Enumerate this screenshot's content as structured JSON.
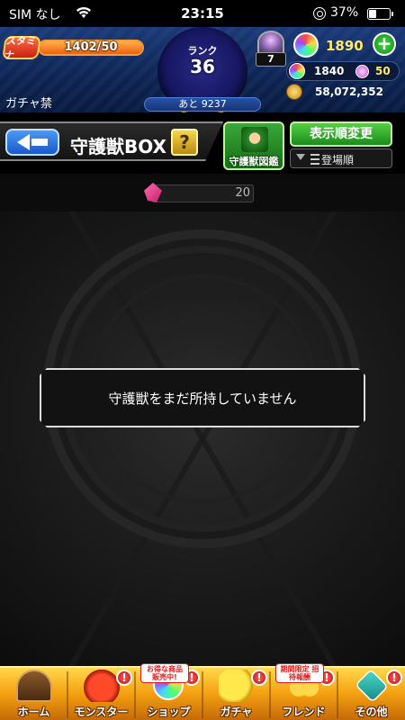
{
  "status_bar": {
    "carrier": "SIM なし",
    "time": "23:15",
    "battery_pct": "37%",
    "battery_level": 0.37
  },
  "header": {
    "stamina_label": "スタミナ",
    "stamina_text": "1402/50",
    "stamina_fill": 1.0,
    "rank_label": "ランク",
    "rank_value": "36",
    "next_rank_text": "あと 9237",
    "gacha_label": "ガチャ禁",
    "tray_count": "7",
    "orb_count": "1890",
    "plus_label": "+",
    "sub_orb_count": "1840",
    "pink_orb_count": "50",
    "coin_count": "58,072,352",
    "colors": {
      "accent": "#ffe86a",
      "header_bg": "#0d2453"
    }
  },
  "title_row": {
    "title": "守護獣BOX",
    "help_label": "?",
    "pedia_label": "守護獣図鑑",
    "sort_button_label": "表示順変更",
    "sort_option_label": "登場順"
  },
  "main": {
    "counter_value": "20",
    "empty_message": "守護獣をまだ所持していません"
  },
  "bottom_nav": {
    "items": [
      {
        "label": "ホーム",
        "icon": "home-icon"
      },
      {
        "label": "モンスター",
        "icon": "monster-icon",
        "badge": "!"
      },
      {
        "label": "ショップ",
        "icon": "shop-icon",
        "badge": "!",
        "promo": "お得な商品 販売中!"
      },
      {
        "label": "ガチャ",
        "icon": "gacha-icon",
        "badge": "!"
      },
      {
        "label": "フレンド",
        "icon": "friend-icon",
        "badge": "!",
        "promo": "期間限定 招待報酬"
      },
      {
        "label": "その他",
        "icon": "other-icon",
        "badge": "!"
      }
    ]
  }
}
